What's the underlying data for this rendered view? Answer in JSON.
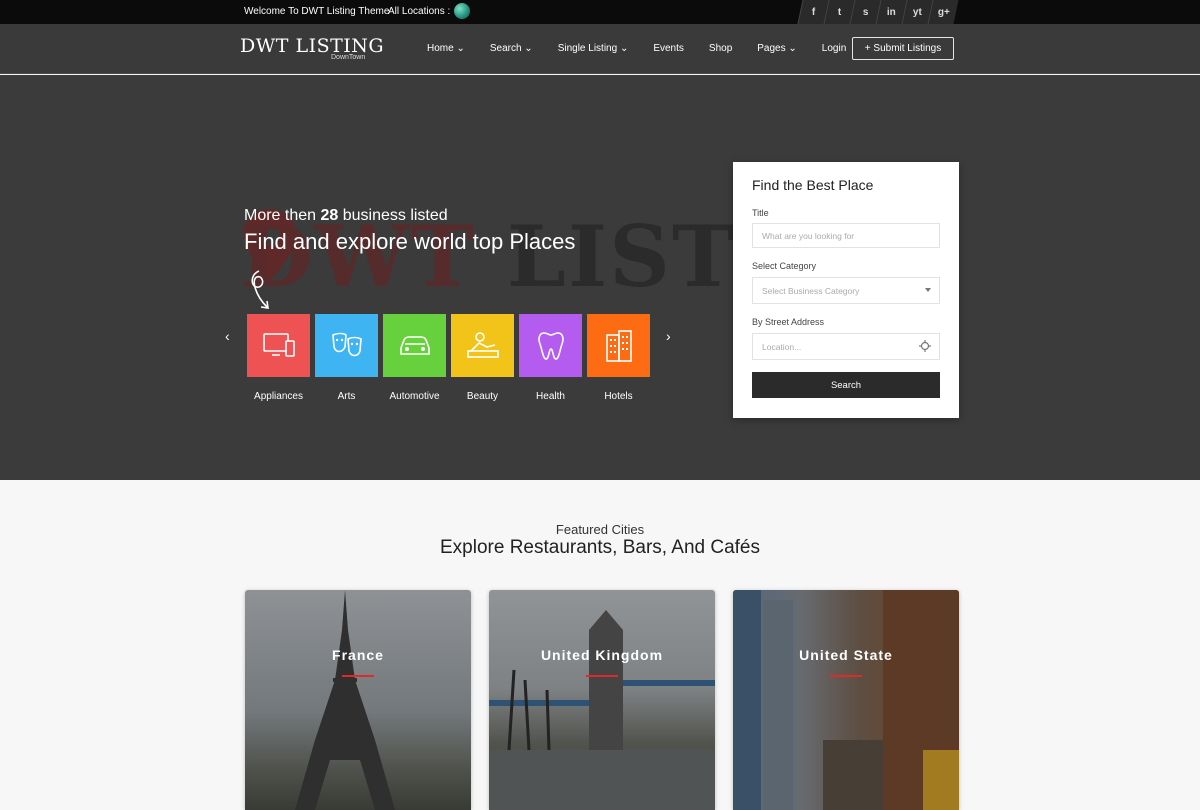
{
  "topbar": {
    "welcome": "Welcome To DWT Listing Theme",
    "locations_label": "All Locations :",
    "social": [
      "f",
      "t",
      "s",
      "in",
      "yt",
      "g+"
    ]
  },
  "nav": {
    "logo": "DWT LISTING",
    "logo_sub": "DownTown",
    "menu": [
      "Home ⌄",
      "Search ⌄",
      "Single Listing ⌄",
      "Events",
      "Shop",
      "Pages ⌄",
      "Login"
    ],
    "submit_label": "+ Submit Listings"
  },
  "hero": {
    "watermark_a": "DWT",
    "watermark_b": " LISTING",
    "sub_prefix": "More then ",
    "sub_count": "28",
    "sub_suffix": " business listed",
    "title": "Find and explore world top Places",
    "prev": "‹",
    "next": "›",
    "categories": [
      {
        "label": "Appliances",
        "color": "#ef5252",
        "icon": "monitor-icon"
      },
      {
        "label": "Arts",
        "color": "#3fb4f2",
        "icon": "theater-masks-icon"
      },
      {
        "label": "Automotive",
        "color": "#66d13c",
        "icon": "car-icon"
      },
      {
        "label": "Beauty",
        "color": "#f2c41a",
        "icon": "spa-icon"
      },
      {
        "label": "Health",
        "color": "#b45cf0",
        "icon": "tooth-icon"
      },
      {
        "label": "Hotels",
        "color": "#fd6b13",
        "icon": "building-icon"
      }
    ]
  },
  "search": {
    "title": "Find the Best Place",
    "title_label": "Title",
    "title_placeholder": "What are you looking for",
    "category_label": "Select Category",
    "category_value": "Select Business Category",
    "address_label": "By Street Address",
    "location_placeholder": "Location...",
    "button": "Search"
  },
  "featured": {
    "kicker": "Featured Cities",
    "heading": "Explore Restaurants, Bars, And Cafés",
    "cities": [
      {
        "name": "France"
      },
      {
        "name": "United Kingdom"
      },
      {
        "name": "United State"
      }
    ]
  }
}
